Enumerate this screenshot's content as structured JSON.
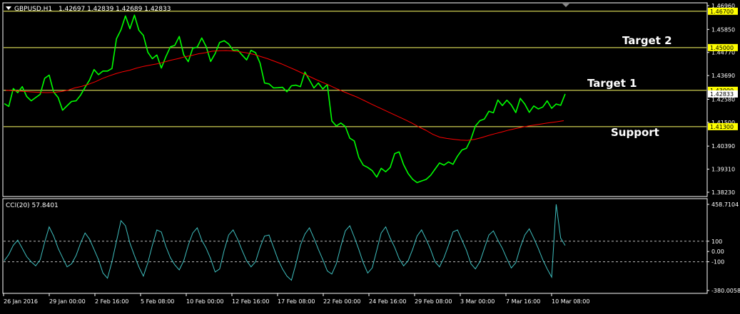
{
  "header": {
    "symbol_label": "GBPUSD,H1",
    "ohlc_text": "1.42697 1.42839 1.42689 1.42833"
  },
  "colors": {
    "background": "#000000",
    "price_line": "#00ff00",
    "moving_average": "#ff0000",
    "level_line": "#ffff66",
    "cci_line": "#3fbfbf",
    "frame": "#ffffff",
    "level_tag_bg": "#ffff00",
    "current_price_tag_bg": "#ffffff"
  },
  "chart_data": [
    {
      "type": "line",
      "title": "GBPUSD,H1",
      "series": [
        {
          "name": "",
          "color": "#00ff00",
          "values": [
            1.4238,
            1.4225,
            1.4308,
            1.4289,
            1.4317,
            1.4271,
            1.4251,
            1.4266,
            1.4281,
            1.4356,
            1.4371,
            1.4292,
            1.4266,
            1.4207,
            1.4228,
            1.4248,
            1.4251,
            1.4277,
            1.4314,
            1.4348,
            1.4397,
            1.4373,
            1.439,
            1.439,
            1.4402,
            1.4541,
            1.4583,
            1.4648,
            1.4588,
            1.4652,
            1.4581,
            1.4557,
            1.4478,
            1.4448,
            1.4465,
            1.4404,
            1.4457,
            1.4503,
            1.451,
            1.4552,
            1.4466,
            1.4434,
            1.4497,
            1.4502,
            1.4545,
            1.4504,
            1.4435,
            1.4472,
            1.4524,
            1.4532,
            1.4517,
            1.4487,
            1.4489,
            1.4465,
            1.4442,
            1.4487,
            1.4476,
            1.4428,
            1.4334,
            1.433,
            1.4311,
            1.4312,
            1.4314,
            1.4293,
            1.4321,
            1.4324,
            1.4317,
            1.4385,
            1.4348,
            1.4311,
            1.4334,
            1.4306,
            1.4327,
            1.4157,
            1.4133,
            1.4147,
            1.4131,
            1.4076,
            1.4063,
            1.3986,
            1.395,
            1.3939,
            1.3924,
            1.3894,
            1.3935,
            1.3919,
            1.3939,
            1.4004,
            1.4012,
            1.3952,
            1.3911,
            1.3884,
            1.3868,
            1.3876,
            1.3883,
            1.3902,
            1.3931,
            1.396,
            1.395,
            1.3965,
            1.3954,
            1.3992,
            1.4021,
            1.4029,
            1.4072,
            1.4133,
            1.4158,
            1.4166,
            1.4202,
            1.4195,
            1.4255,
            1.4229,
            1.4254,
            1.4232,
            1.4196,
            1.4262,
            1.4236,
            1.4197,
            1.4227,
            1.4213,
            1.4222,
            1.4251,
            1.4216,
            1.4236,
            1.423,
            1.4283
          ]
        },
        {
          "name": "",
          "color": "#ff0000",
          "values": [
            1.43,
            1.4298,
            1.4296,
            1.4294,
            1.4292,
            1.429,
            1.4289,
            1.429,
            1.4294,
            1.43,
            1.4311,
            1.4318,
            1.4328,
            1.434,
            1.4355,
            1.4367,
            1.4378,
            1.4387,
            1.4394,
            1.4404,
            1.4412,
            1.4418,
            1.4424,
            1.4432,
            1.4441,
            1.4448,
            1.4457,
            1.4463,
            1.4471,
            1.4476,
            1.4483,
            1.4485,
            1.4486,
            1.4484,
            1.448,
            1.4475,
            1.4468,
            1.4458,
            1.4448,
            1.4436,
            1.4424,
            1.441,
            1.4396,
            1.4381,
            1.4366,
            1.4351,
            1.4337,
            1.4323,
            1.4308,
            1.4294,
            1.4281,
            1.4268,
            1.4253,
            1.4237,
            1.4222,
            1.4207,
            1.4192,
            1.4177,
            1.4162,
            1.4146,
            1.4128,
            1.4113,
            1.4094,
            1.4081,
            1.4075,
            1.4071,
            1.4067,
            1.4066,
            1.407,
            1.4078,
            1.4088,
            1.4097,
            1.4105,
            1.4114,
            1.4121,
            1.4128,
            1.4134,
            1.4139,
            1.4144,
            1.4149,
            1.4153,
            1.4158
          ]
        }
      ],
      "y_ticks": [
        "1.46960",
        "1.45850",
        "1.44770",
        "1.43690",
        "1.42580",
        "1.41500",
        "1.40390",
        "1.39310",
        "1.38230"
      ],
      "ylim": [
        1.3823,
        1.4696
      ],
      "grid": false,
      "horizontal_levels": [
        {
          "value": 1.467,
          "tag": "1.46700",
          "annotation": ""
        },
        {
          "value": 1.45,
          "tag": "1.45000",
          "annotation": "Target 2"
        },
        {
          "value": 1.43,
          "tag": "1.43000",
          "annotation": "Target 1"
        },
        {
          "value": 1.4283,
          "tag": "1.42833",
          "annotation": ""
        },
        {
          "value": 1.413,
          "tag": "1.41300",
          "annotation": "Support"
        }
      ]
    },
    {
      "type": "line",
      "title": "CCI(20) 57.8401",
      "series": [
        {
          "name": "CCI(20)",
          "color": "#3fbfbf",
          "values": [
            -90,
            -30,
            60,
            110,
            30,
            -50,
            -100,
            -140,
            -80,
            90,
            240,
            150,
            30,
            -60,
            -150,
            -120,
            -40,
            80,
            180,
            120,
            20,
            -80,
            -210,
            -260,
            -100,
            100,
            300,
            250,
            80,
            -40,
            -150,
            -240,
            -110,
            60,
            210,
            190,
            50,
            -60,
            -130,
            -180,
            -90,
            60,
            180,
            230,
            110,
            30,
            -70,
            -200,
            -170,
            10,
            160,
            210,
            120,
            10,
            -90,
            -150,
            -100,
            40,
            150,
            160,
            40,
            -80,
            -170,
            -240,
            -280,
            -120,
            60,
            170,
            230,
            130,
            20,
            -80,
            -190,
            -220,
            -120,
            50,
            200,
            250,
            140,
            20,
            -110,
            -210,
            -160,
            10,
            180,
            240,
            130,
            40,
            -70,
            -140,
            -90,
            20,
            150,
            210,
            120,
            20,
            -100,
            -150,
            -60,
            60,
            190,
            210,
            110,
            10,
            -120,
            -170,
            -100,
            30,
            160,
            200,
            110,
            30,
            -70,
            -160,
            -110,
            40,
            160,
            220,
            130,
            30,
            -80,
            -170,
            -250,
            459,
            130,
            58
          ]
        }
      ],
      "y_ticks": [
        "458.7104",
        "100",
        "0.00",
        "-100",
        "-380.0058"
      ],
      "ylim": [
        -380.0058,
        458.7104
      ],
      "levels": [
        100,
        -100
      ],
      "grid": false,
      "x_ticks": [
        "26 Jan 2016",
        "29 Jan 00:00",
        "2 Feb 16:00",
        "5 Feb 08:00",
        "10 Feb 00:00",
        "12 Feb 16:00",
        "17 Feb 08:00",
        "22 Feb 00:00",
        "24 Feb 16:00",
        "29 Feb 08:00",
        "3 Mar 00:00",
        "7 Mar 16:00",
        "10 Mar 08:00"
      ]
    }
  ]
}
